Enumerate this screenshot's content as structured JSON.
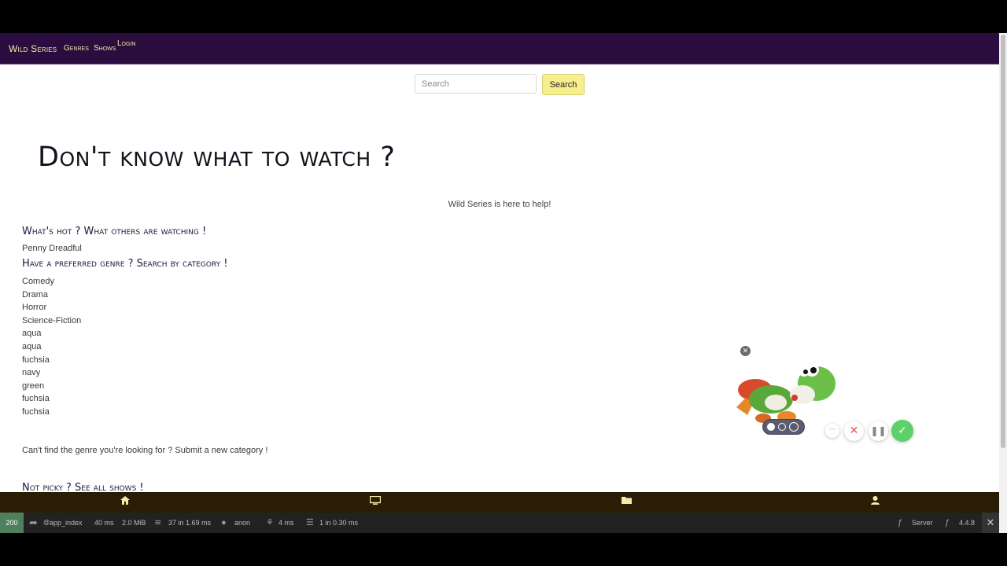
{
  "navbar": {
    "brand": "Wild Series",
    "links": [
      {
        "label": "Genres"
      },
      {
        "label": "Shows"
      },
      {
        "label": "Login"
      }
    ]
  },
  "search": {
    "placeholder": "Search",
    "button_label": "Search"
  },
  "hero": {
    "title": "Don't know what to watch ?",
    "tagline": "Wild Series is here to help!"
  },
  "sections": {
    "hot_heading": "What's hot ? What others are watching !",
    "hot_items": [
      "Penny Dreadful"
    ],
    "genre_heading": "Have a preferred genre ? Search by category !",
    "categories": [
      "Comedy",
      "Drama",
      "Horror",
      "Science-Fiction",
      "aqua",
      "aqua",
      "fuchsia",
      "navy",
      "green",
      "fuchsia",
      "fuchsia"
    ],
    "submit_text": "Can't find the genre you're looking for ? Submit a new category !",
    "all_shows_heading": "Not picky ? See all shows !"
  },
  "bottom_nav": {
    "icons": [
      "home-icon",
      "tv-icon",
      "folder-icon",
      "user-icon"
    ]
  },
  "debug_toolbar": {
    "status_code": "200",
    "route": "app_index",
    "route_prefix": "@",
    "time": "40 ms",
    "memory": "2.0 MiB",
    "queries": "37 in 1.69 ms",
    "user": "anon",
    "twig_time": "4 ms",
    "db": "1 in 0.30 ms",
    "server_label": "Server",
    "version": "4.4.8",
    "colors": {
      "status_bg": "#4f805d"
    }
  },
  "widget": {
    "close_icon": "close-icon",
    "mascot": "yoshi-plush-image",
    "controls": [
      "more-icon",
      "close-icon",
      "pause-icon",
      "check-icon"
    ]
  },
  "colors": {
    "navbar_bg": "#2a0d3e",
    "accent_yellow": "#f7ef8e",
    "bottom_nav_bg": "#2a1d05",
    "toolbar_bg": "#222222"
  }
}
